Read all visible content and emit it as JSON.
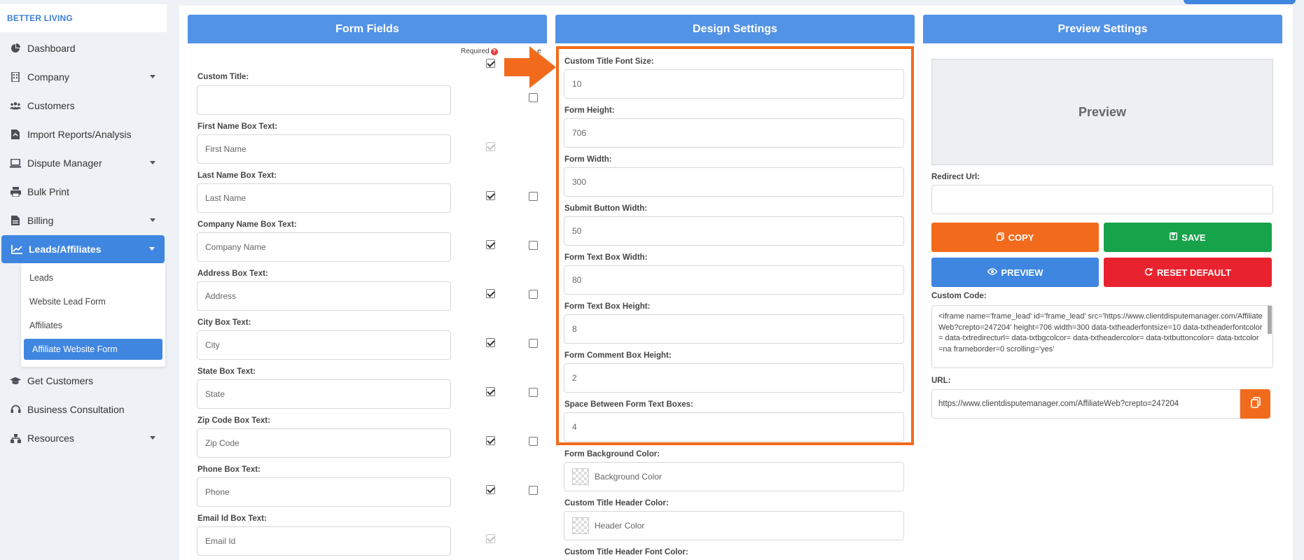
{
  "brand": "BETTER LIVING",
  "sidebar": {
    "items": [
      {
        "label": "Dashboard",
        "icon": "pie-chart-icon"
      },
      {
        "label": "Company",
        "icon": "building-icon"
      },
      {
        "label": "Customers",
        "icon": "users-icon"
      },
      {
        "label": "Import Reports/Analysis",
        "icon": "file-import-icon"
      },
      {
        "label": "Dispute Manager",
        "icon": "laptop-icon"
      },
      {
        "label": "Bulk Print",
        "icon": "printer-icon"
      },
      {
        "label": "Billing",
        "icon": "invoice-icon"
      },
      {
        "label": "Leads/Affiliates",
        "icon": "chart-line-icon"
      },
      {
        "label": "Get Customers",
        "icon": "graduation-cap-icon"
      },
      {
        "label": "Business Consultation",
        "icon": "headset-icon"
      },
      {
        "label": "Resources",
        "icon": "sitemap-icon"
      }
    ],
    "submenu": [
      "Leads",
      "Website Lead Form",
      "Affiliates",
      "Affiliate Website Form"
    ]
  },
  "form_fields": {
    "title": "Form Fields",
    "required_label": "Required",
    "hide_label": "e",
    "fields": [
      {
        "label": "Custom Title:",
        "value": "",
        "placeholder": ""
      },
      {
        "label": "First Name Box Text:",
        "value": "",
        "placeholder": "First Name"
      },
      {
        "label": "Last Name Box Text:",
        "value": "",
        "placeholder": "Last Name"
      },
      {
        "label": "Company Name Box Text:",
        "value": "",
        "placeholder": "Company Name"
      },
      {
        "label": "Address Box Text:",
        "value": "",
        "placeholder": "Address"
      },
      {
        "label": "City Box Text:",
        "value": "",
        "placeholder": "City"
      },
      {
        "label": "State Box Text:",
        "value": "",
        "placeholder": "State"
      },
      {
        "label": "Zip Code Box Text:",
        "value": "",
        "placeholder": "Zip Code"
      },
      {
        "label": "Phone Box Text:",
        "value": "",
        "placeholder": "Phone"
      },
      {
        "label": "Email Id Box Text:",
        "value": "",
        "placeholder": "Email Id"
      }
    ]
  },
  "design": {
    "title": "Design Settings",
    "fields": [
      {
        "label": "Custom Title Font Size:",
        "value": "10"
      },
      {
        "label": "Form Height:",
        "value": "706"
      },
      {
        "label": "Form Width:",
        "value": "300"
      },
      {
        "label": "Submit Button Width:",
        "value": "50"
      },
      {
        "label": "Form Text Box Width:",
        "value": "80"
      },
      {
        "label": "Form Text Box Height:",
        "value": "8"
      },
      {
        "label": "Form Comment Box Height:",
        "value": "2"
      },
      {
        "label": "Space Between Form Text Boxes:",
        "value": "4"
      }
    ],
    "color_fields": [
      {
        "label": "Form Background Color:",
        "placeholder": "Background Color"
      },
      {
        "label": "Custom Title Header Color:",
        "placeholder": "Header Color"
      },
      {
        "label": "Custom Title Header Font Color:",
        "placeholder": ""
      }
    ]
  },
  "preview": {
    "title": "Preview Settings",
    "box_label": "Preview",
    "redirect_label": "Redirect Url:",
    "redirect_value": "",
    "copy_label": "COPY",
    "save_label": "SAVE",
    "preview_label": "PREVIEW",
    "reset_label": "RESET DEFAULT",
    "code_label": "Custom Code:",
    "code_value": "<iframe name='frame_lead' id='frame_lead' src='https://www.clientdisputemanager.com/AffiliateWeb?crepto=247204' height=706 width=300 data-txtheaderfontsize=10 data-txtheaderfontcolor= data-txtredirecturl= data-txtbgcolcor= data-txtheadercolor= data-txtbuttoncolor= data-txtcolor=na frameborder=0  scrolling='yes'",
    "url_label": "URL:",
    "url_value": "https://www.clientdisputemanager.com/AffiliateWeb?crepto=247204"
  },
  "colors": {
    "accent": "#3f86e0",
    "header": "#5393e6",
    "highlight": "#f26b1d",
    "save": "#17a34a",
    "reset": "#e8232f"
  }
}
